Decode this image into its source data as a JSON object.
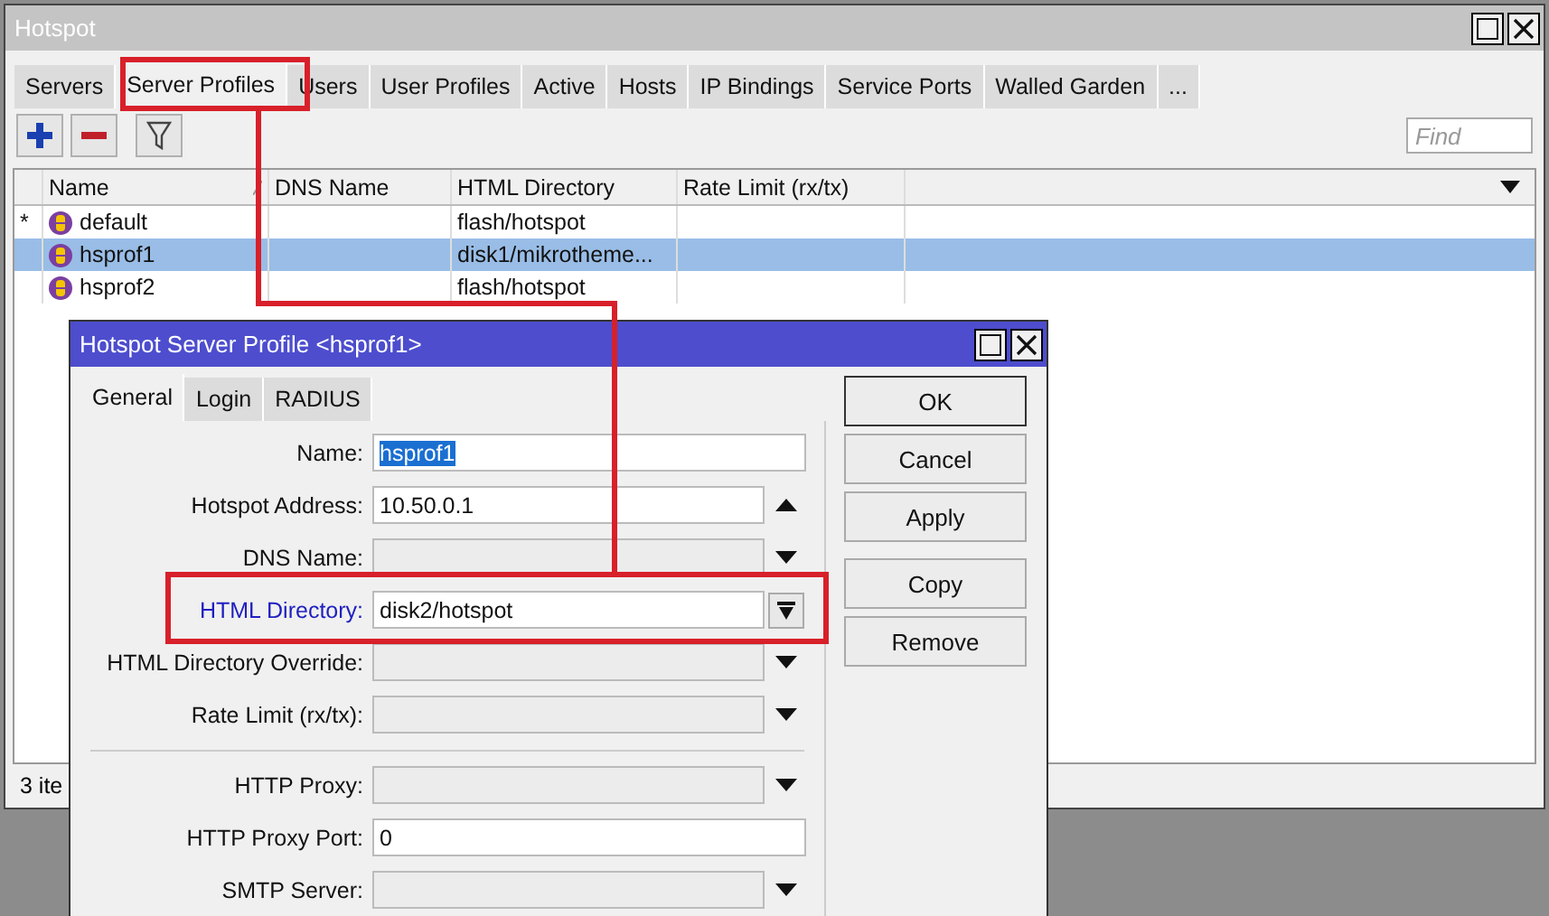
{
  "window": {
    "title": "Hotspot"
  },
  "tabs": [
    {
      "label": "Servers",
      "selected": false
    },
    {
      "label": "Server Profiles",
      "selected": true
    },
    {
      "label": "Users",
      "selected": false
    },
    {
      "label": "User Profiles",
      "selected": false
    },
    {
      "label": "Active",
      "selected": false
    },
    {
      "label": "Hosts",
      "selected": false
    },
    {
      "label": "IP Bindings",
      "selected": false
    },
    {
      "label": "Service Ports",
      "selected": false
    },
    {
      "label": "Walled Garden",
      "selected": false
    },
    {
      "label": "...",
      "selected": false
    }
  ],
  "toolbar": {
    "find_placeholder": "Find"
  },
  "table": {
    "columns": [
      "Name",
      "DNS Name",
      "HTML Directory",
      "Rate Limit (rx/tx)"
    ],
    "rows": [
      {
        "marker": "*",
        "name": "default",
        "html_directory": "flash/hotspot",
        "selected": false
      },
      {
        "name": "hsprof1",
        "html_directory": "disk1/mikrotheme...",
        "selected": true
      },
      {
        "name": "hsprof2",
        "html_directory": "flash/hotspot",
        "selected": false
      }
    ]
  },
  "status_bar": "3 ite",
  "dialog": {
    "title": "Hotspot Server Profile <hsprof1>",
    "tabs": [
      {
        "label": "General",
        "selected": true
      },
      {
        "label": "Login",
        "selected": false
      },
      {
        "label": "RADIUS",
        "selected": false
      }
    ],
    "field_groups": [
      [
        {
          "label": "Name:",
          "value": "hsprof1",
          "kind": "text",
          "value_selected": true,
          "highlight": false,
          "enabled": true
        },
        {
          "label": "Hotspot Address:",
          "value": "10.50.0.1",
          "kind": "up",
          "value_selected": false,
          "highlight": false,
          "enabled": true
        },
        {
          "label": "DNS Name:",
          "kind": "down",
          "highlight": false,
          "enabled": false
        },
        {
          "label": "HTML Directory:",
          "value": "disk2/hotspot",
          "kind": "combo",
          "value_selected": false,
          "highlight": true,
          "enabled": true
        },
        {
          "label": "HTML Directory Override:",
          "kind": "down",
          "highlight": false,
          "enabled": false
        },
        {
          "label": "Rate Limit (rx/tx):",
          "kind": "down",
          "highlight": false,
          "enabled": false
        }
      ],
      [
        {
          "label": "HTTP Proxy:",
          "kind": "down",
          "highlight": false,
          "enabled": false
        },
        {
          "label": "HTTP Proxy Port:",
          "value": "0",
          "kind": "text",
          "value_selected": false,
          "highlight": false,
          "enabled": true
        },
        {
          "label": "SMTP Server:",
          "kind": "down",
          "highlight": false,
          "enabled": false
        }
      ]
    ],
    "button_groups": [
      [
        {
          "label": "OK",
          "default": true
        },
        {
          "label": "Cancel",
          "default": false
        },
        {
          "label": "Apply",
          "default": false
        }
      ],
      [
        {
          "label": "Copy",
          "default": false
        },
        {
          "label": "Remove",
          "default": false
        }
      ]
    ]
  }
}
